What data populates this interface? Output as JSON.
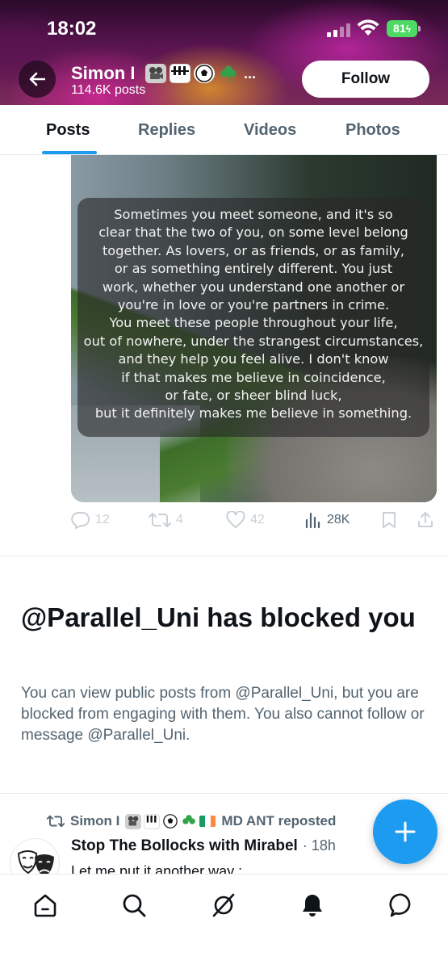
{
  "status_bar": {
    "time": "18:02",
    "battery": "81"
  },
  "profile": {
    "name": "Simon I",
    "posts_count": "114.6K posts",
    "follow_label": "Follow"
  },
  "tabs": [
    {
      "label": "Posts",
      "active": true
    },
    {
      "label": "Replies",
      "active": false
    },
    {
      "label": "Videos",
      "active": false
    },
    {
      "label": "Photos",
      "active": false
    }
  ],
  "post": {
    "image_quote_lines": [
      "Sometimes you meet someone, and it's so",
      "clear that the two of you, on some level belong",
      "together. As lovers, or as friends, or as family,",
      "or as something entirely different. You just",
      "work, whether you understand one another or",
      "you're in love or you're partners in crime.",
      "You meet these people throughout your life,",
      "out of nowhere, under the strangest circumstances,",
      "and they help you feel alive. I don't know",
      "if that makes me believe in coincidence,",
      "or fate, or sheer blind luck,",
      "but it definitely makes me believe in something."
    ],
    "replies": "12",
    "reposts": "4",
    "likes": "42",
    "views": "28K"
  },
  "blocked_notice": {
    "title": "@Parallel_Uni has blocked you",
    "body": "You can view public posts from @Parallel_Uni, but you are blocked from engaging with them. You also cannot follow or message @Parallel_Uni."
  },
  "next_post": {
    "reposter_name": "Simon I",
    "reposter_suffix": "MD ANT reposted",
    "author": "Stop The Bollocks with Mirabel",
    "time": "· 18h",
    "text": "Let me put it another way :"
  },
  "icons": {
    "back": "back-arrow-icon",
    "reply": "reply-icon",
    "repost": "repost-icon",
    "like": "heart-icon",
    "views": "views-icon",
    "bookmark": "bookmark-icon",
    "share": "share-icon",
    "compose": "plus-icon",
    "nav": [
      "home-icon",
      "search-icon",
      "grok-icon",
      "notifications-icon",
      "messages-icon"
    ]
  },
  "colors": {
    "accent": "#1d9bf0",
    "text": "#0f1419",
    "muted": "#536471",
    "battery": "#4cd964"
  }
}
